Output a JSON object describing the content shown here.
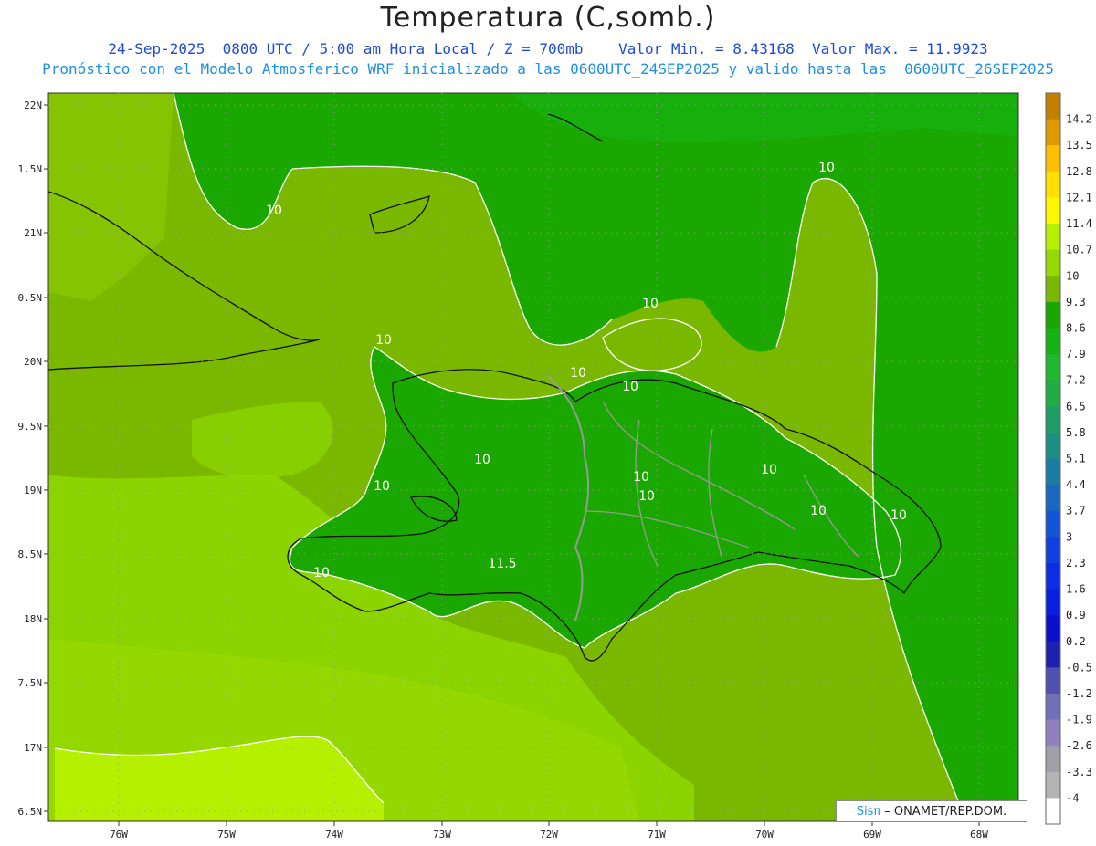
{
  "title": "Temperatura (C,somb.)",
  "subtitle_line1": "24-Sep-2025  0800 UTC / 5:00 am Hora Local / Z = 700mb    Valor Min. = 8.43168  Valor Max. = 11.9923",
  "subtitle_line2": "Pronóstico con el Modelo Atmosferico WRF inicializado a las 0600UTC_24SEP2025 y valido hasta las  0600UTC_26SEP2025",
  "credit": {
    "brand": "Sisπ",
    "org": "– ONAMET/REP.DOM."
  },
  "axes": {
    "lon_ticks": [
      "76W",
      "75W",
      "74W",
      "73W",
      "72W",
      "71W",
      "70W",
      "69W",
      "68W"
    ],
    "lat_ticks": [
      "22N",
      "1.5N",
      "21N",
      "0.5N",
      "20N",
      "9.5N",
      "19N",
      "8.5N",
      "18N",
      "7.5N",
      "17N",
      "6.5N"
    ]
  },
  "contour_labels": [
    "10",
    "10",
    "10",
    "10",
    "10",
    "10",
    "10",
    "10",
    "10",
    "10",
    "10",
    "10",
    "10",
    "10",
    "11.5"
  ],
  "colorbar": {
    "labels": [
      "14.2",
      "13.5",
      "12.8",
      "12.1",
      "11.4",
      "10.7",
      "10",
      "9.3",
      "8.6",
      "7.9",
      "7.2",
      "6.5",
      "5.8",
      "5.1",
      "4.4",
      "3.7",
      "3",
      "2.3",
      "1.6",
      "0.9",
      "0.2",
      "-0.5",
      "-1.2",
      "-1.9",
      "-2.6",
      "-3.3",
      "-4"
    ],
    "colors": [
      "#c08000",
      "#e09a00",
      "#ffbf00",
      "#ffe000",
      "#fff700",
      "#b5f000",
      "#94d800",
      "#7ab800",
      "#1aa800",
      "#14b414",
      "#20b830",
      "#22ac44",
      "#1e9e66",
      "#1c8e84",
      "#1a7ca2",
      "#1868c0",
      "#1454d6",
      "#1040e0",
      "#0c2ee4",
      "#0a1ee0",
      "#0a10cc",
      "#2020b0",
      "#5050b0",
      "#7070b8",
      "#9080c0",
      "#a0a0a8",
      "#b4b4b4",
      "#ffffff"
    ]
  }
}
